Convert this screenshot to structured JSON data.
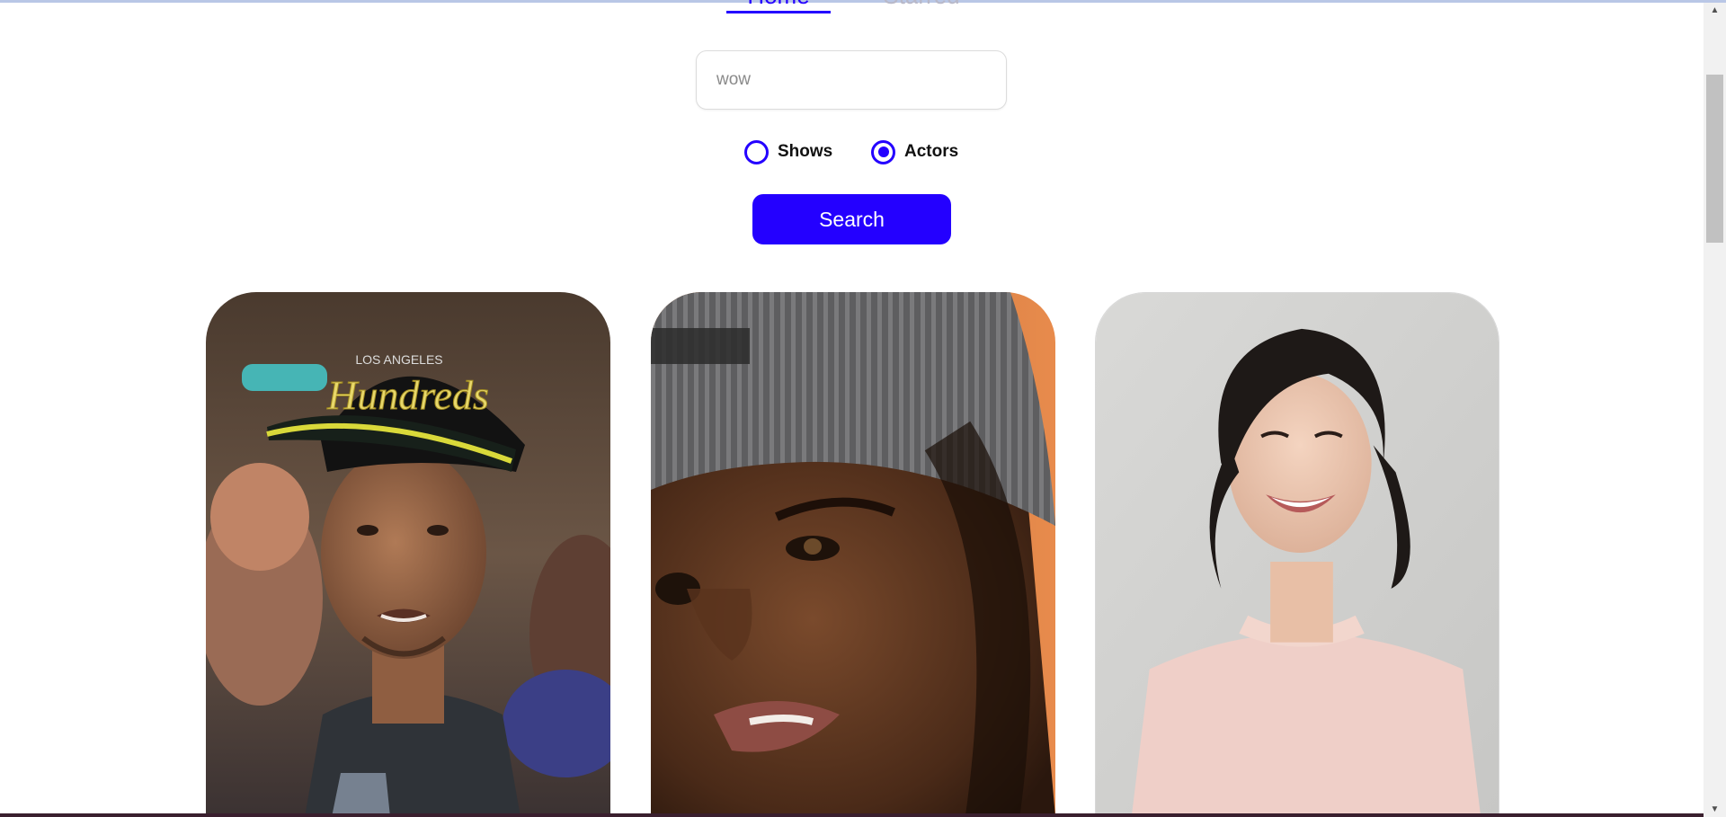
{
  "nav": {
    "tabs": [
      {
        "label": "Home",
        "active": true
      },
      {
        "label": "Starred",
        "active": false
      }
    ]
  },
  "search": {
    "value": "wow",
    "placeholder": "",
    "button_label": "Search"
  },
  "filters": {
    "options": [
      {
        "label": "Shows",
        "selected": false
      },
      {
        "label": "Actors",
        "selected": true
      }
    ]
  },
  "results": {
    "cards": [
      {
        "image": "actor-photo-man-black-cap-los-angeles-hundreds"
      },
      {
        "image": "actor-photo-young-man-grey-beanie"
      },
      {
        "image": "actor-photo-smiling-woman-pink-sweater"
      }
    ],
    "cap_text_small": "LOS ANGELES",
    "cap_text_script": "Hundreds"
  },
  "colors": {
    "accent": "#2400ff",
    "inactive_tab": "#b8b8c8",
    "background": "#ffffff"
  }
}
